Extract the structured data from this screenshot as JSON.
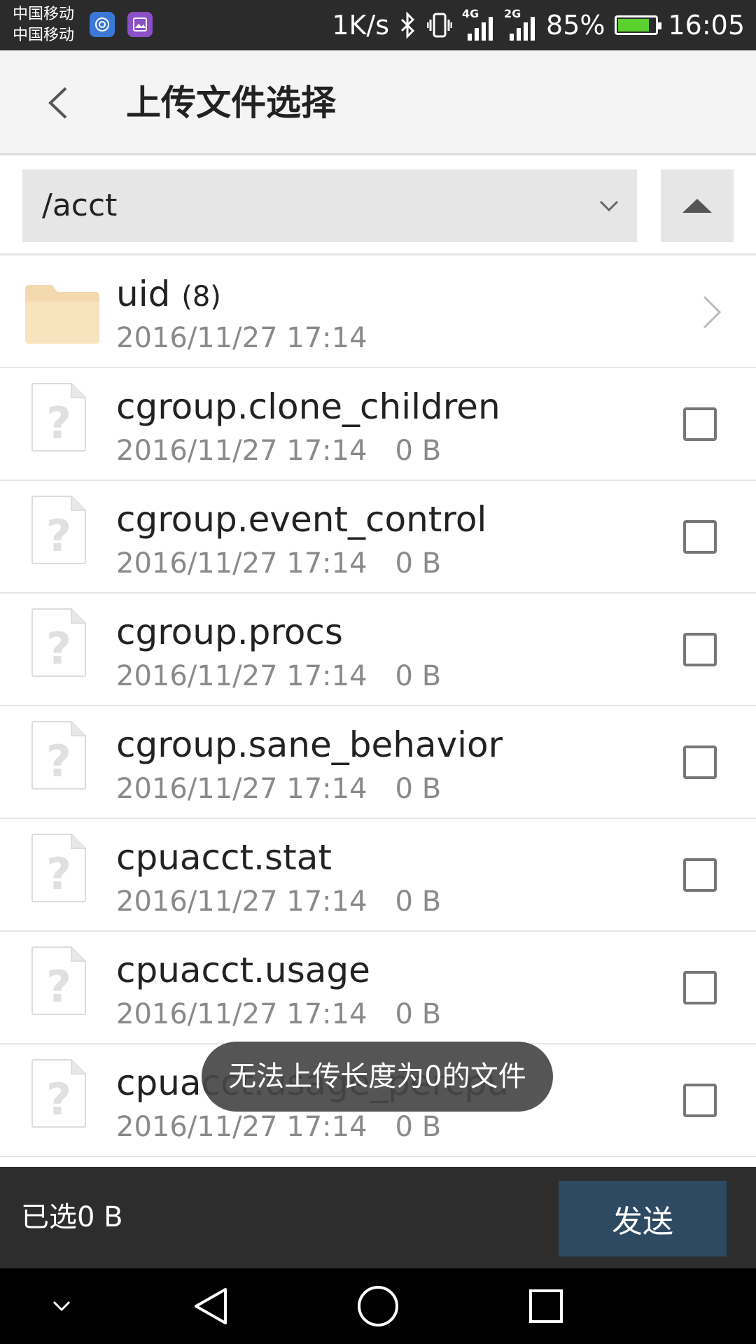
{
  "status_bar": {
    "carrier_1": "中国移动",
    "carrier_2": "中国移动",
    "speed": "1K/s",
    "network_4g": "4G",
    "network_2g": "2G",
    "battery": "85%",
    "battery_level": 0.85,
    "time": "16:05"
  },
  "header": {
    "title": "上传文件选择"
  },
  "path_bar": {
    "current_path": "/acct"
  },
  "folder": {
    "name": "uid",
    "count": "(8)",
    "date": "2016/11/27 17:14"
  },
  "files": [
    {
      "name": "cgroup.clone_children",
      "date": "2016/11/27 17:14",
      "size": "0 B"
    },
    {
      "name": "cgroup.event_control",
      "date": "2016/11/27 17:14",
      "size": "0 B"
    },
    {
      "name": "cgroup.procs",
      "date": "2016/11/27 17:14",
      "size": "0 B"
    },
    {
      "name": "cgroup.sane_behavior",
      "date": "2016/11/27 17:14",
      "size": "0 B"
    },
    {
      "name": "cpuacct.stat",
      "date": "2016/11/27 17:14",
      "size": "0 B"
    },
    {
      "name": "cpuacct.usage",
      "date": "2016/11/27 17:14",
      "size": "0 B"
    },
    {
      "name": "cpuacct.usage_percpu",
      "date": "2016/11/27 17:14",
      "size": "0 B"
    }
  ],
  "toast": {
    "message": "无法上传长度为0的文件"
  },
  "bottom_bar": {
    "selected_label": "已选0 B",
    "send_label": "发送"
  },
  "colors": {
    "status_bar": "#2b2b2b",
    "send_button": "#2e4a63",
    "bottom_bar": "#2d2d2d",
    "folder": "#f5deb3"
  }
}
